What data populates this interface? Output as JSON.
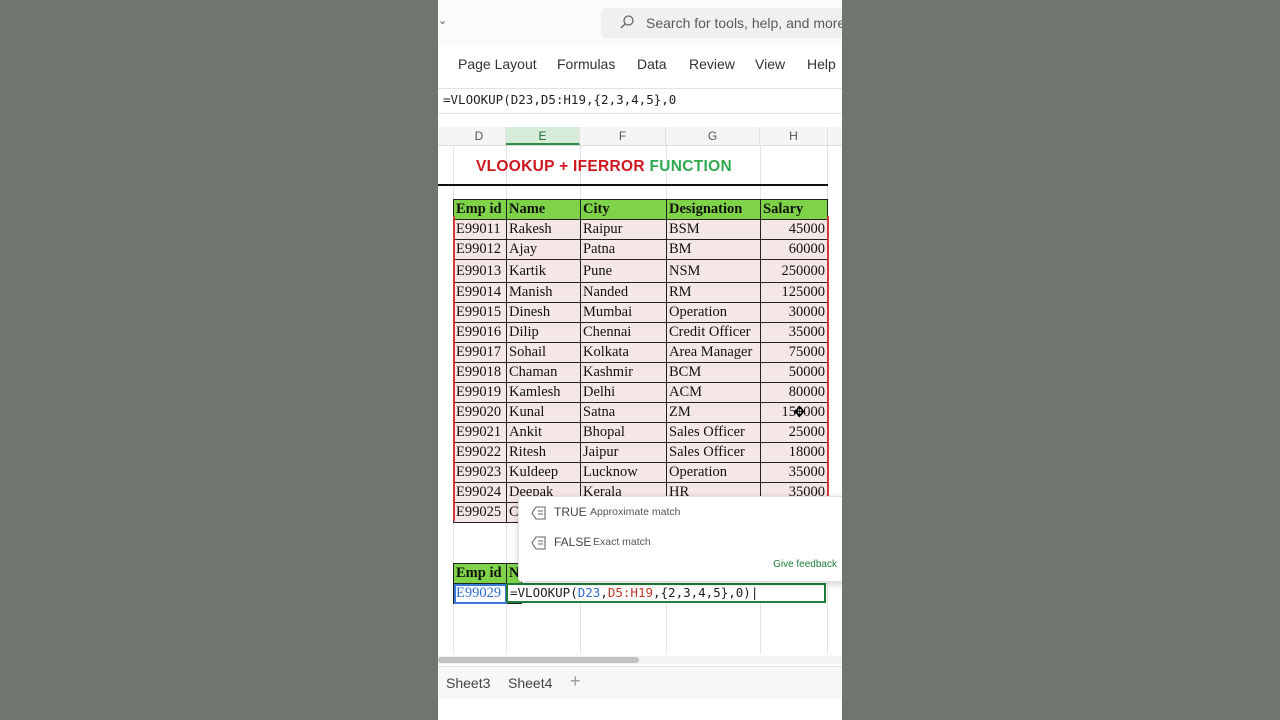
{
  "search": {
    "placeholder": "Search for tools, help, and more"
  },
  "ribbon": {
    "tabs": [
      "Page Layout",
      "Formulas",
      "Data",
      "Review",
      "View",
      "Help"
    ]
  },
  "formula_bar": {
    "text": "=VLOOKUP(D23,D5:H19,{2,3,4,5},0"
  },
  "columns": [
    "D",
    "E",
    "F",
    "G",
    "H"
  ],
  "selected_column": "E",
  "title": {
    "part1": "VLOOKUP + IFERROR",
    "part2": "FUNCTION"
  },
  "table": {
    "headers": [
      "Emp id",
      "Name",
      "City",
      "Designation",
      "Salary"
    ],
    "rows": [
      [
        "E99011",
        "Rakesh",
        "Raipur",
        "BSM",
        "45000"
      ],
      [
        "E99012",
        "Ajay",
        "Patna",
        "BM",
        "60000"
      ],
      [
        "E99013",
        "Kartik",
        "Pune",
        "NSM",
        "250000"
      ],
      [
        "E99014",
        "Manish",
        "Nanded",
        "RM",
        "125000"
      ],
      [
        "E99015",
        "Dinesh",
        "Mumbai",
        "Operation",
        "30000"
      ],
      [
        "E99016",
        "Dilip",
        "Chennai",
        "Credit Officer",
        "35000"
      ],
      [
        "E99017",
        "Sohail",
        "Kolkata",
        "Area Manager",
        "75000"
      ],
      [
        "E99018",
        "Chaman",
        "Kashmir",
        "BCM",
        "50000"
      ],
      [
        "E99019",
        "Kamlesh",
        "Delhi",
        "ACM",
        "80000"
      ],
      [
        "E99020",
        "Kunal",
        "Satna",
        "ZM",
        "150000"
      ],
      [
        "E99021",
        "Ankit",
        "Bhopal",
        "Sales Officer",
        "25000"
      ],
      [
        "E99022",
        "Ritesh",
        "Jaipur",
        "Sales Officer",
        "18000"
      ],
      [
        "E99023",
        "Kuldeep",
        "Lucknow",
        "Operation",
        "35000"
      ],
      [
        "E99024",
        "Deepak",
        "Kerala",
        "HR",
        "35000"
      ],
      [
        "E99025",
        "C",
        "",
        "",
        ""
      ]
    ]
  },
  "lookup": {
    "headers": [
      "Emp id",
      "N"
    ],
    "emp_id": "E99029",
    "formula_parts": {
      "prefix": "=VLOOKUP(",
      "ref1": "D23",
      "sep": ",",
      "ref2": "D5:H19",
      "rest": ",{2,3,4,5},0)"
    }
  },
  "autocomplete": {
    "options": [
      {
        "value": "TRUE",
        "description": "Approximate match"
      },
      {
        "value": "FALSE",
        "description": "Exact match"
      }
    ],
    "feedback": "Give feedback"
  },
  "sheets": [
    "Sheet3",
    "Sheet4"
  ],
  "add_sheet": "+",
  "colors": {
    "header_green": "#7ed348",
    "title_red": "#d0161f",
    "title_green": "#2fa84f",
    "row_pink": "#f6e7e7",
    "excel_green": "#1e7d3a"
  }
}
